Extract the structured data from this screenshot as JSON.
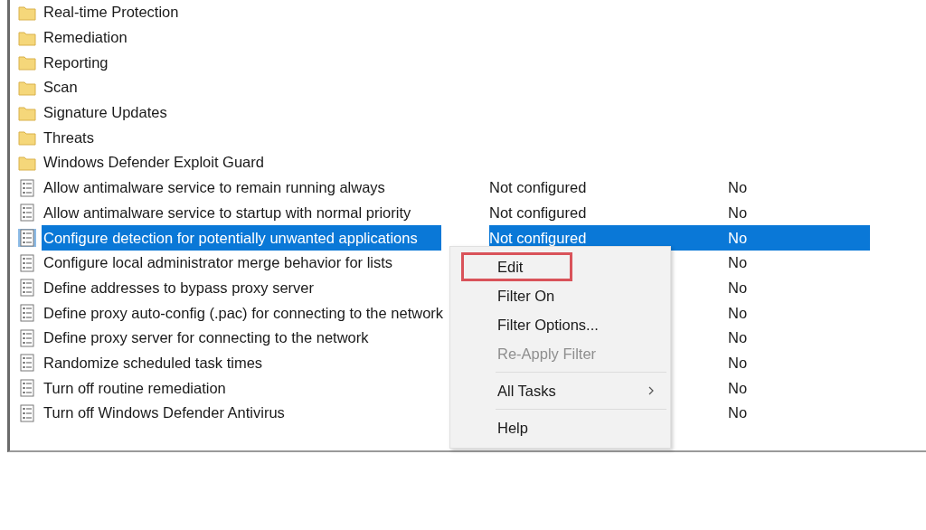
{
  "list": {
    "rows": [
      {
        "kind": "folder",
        "name": "Real-time Protection",
        "selected": false
      },
      {
        "kind": "folder",
        "name": "Remediation",
        "selected": false
      },
      {
        "kind": "folder",
        "name": "Reporting",
        "selected": false
      },
      {
        "kind": "folder",
        "name": "Scan",
        "selected": false
      },
      {
        "kind": "folder",
        "name": "Signature Updates",
        "selected": false
      },
      {
        "kind": "folder",
        "name": "Threats",
        "selected": false
      },
      {
        "kind": "folder",
        "name": "Windows Defender Exploit Guard",
        "selected": false
      },
      {
        "kind": "setting",
        "name": "Allow antimalware service to remain running always",
        "state": "Not configured",
        "comment": "No",
        "selected": false
      },
      {
        "kind": "setting",
        "name": "Allow antimalware service to startup with normal priority",
        "state": "Not configured",
        "comment": "No",
        "selected": false
      },
      {
        "kind": "setting",
        "name": "Configure detection for potentially unwanted applications",
        "state": "Not configured",
        "comment": "No",
        "selected": true
      },
      {
        "kind": "setting",
        "name": "Configure local administrator merge behavior for lists",
        "comment": "No",
        "selected": false
      },
      {
        "kind": "setting",
        "name": "Define addresses to bypass proxy server",
        "comment": "No",
        "selected": false
      },
      {
        "kind": "setting",
        "name": "Define proxy auto-config (.pac) for connecting to the network",
        "comment": "No",
        "selected": false
      },
      {
        "kind": "setting",
        "name": "Define proxy server for connecting to the network",
        "comment": "No",
        "selected": false
      },
      {
        "kind": "setting",
        "name": "Randomize scheduled task times",
        "comment": "No",
        "selected": false
      },
      {
        "kind": "setting",
        "name": "Turn off routine remediation",
        "comment": "No",
        "selected": false
      },
      {
        "kind": "setting",
        "name": "Turn off Windows Defender Antivirus",
        "comment": "No",
        "selected": false
      }
    ]
  },
  "context_menu": {
    "items": [
      {
        "label": "Edit",
        "disabled": false,
        "highlighted": true,
        "submenu": false,
        "separator_before": false
      },
      {
        "label": "Filter On",
        "disabled": false,
        "highlighted": false,
        "submenu": false,
        "separator_before": false
      },
      {
        "label": "Filter Options...",
        "disabled": false,
        "highlighted": false,
        "submenu": false,
        "separator_before": false
      },
      {
        "label": "Re-Apply Filter",
        "disabled": true,
        "highlighted": false,
        "submenu": false,
        "separator_before": false
      },
      {
        "label": "All Tasks",
        "disabled": false,
        "highlighted": false,
        "submenu": true,
        "separator_before": true
      },
      {
        "label": "Help",
        "disabled": false,
        "highlighted": false,
        "submenu": false,
        "separator_before": true
      }
    ]
  }
}
